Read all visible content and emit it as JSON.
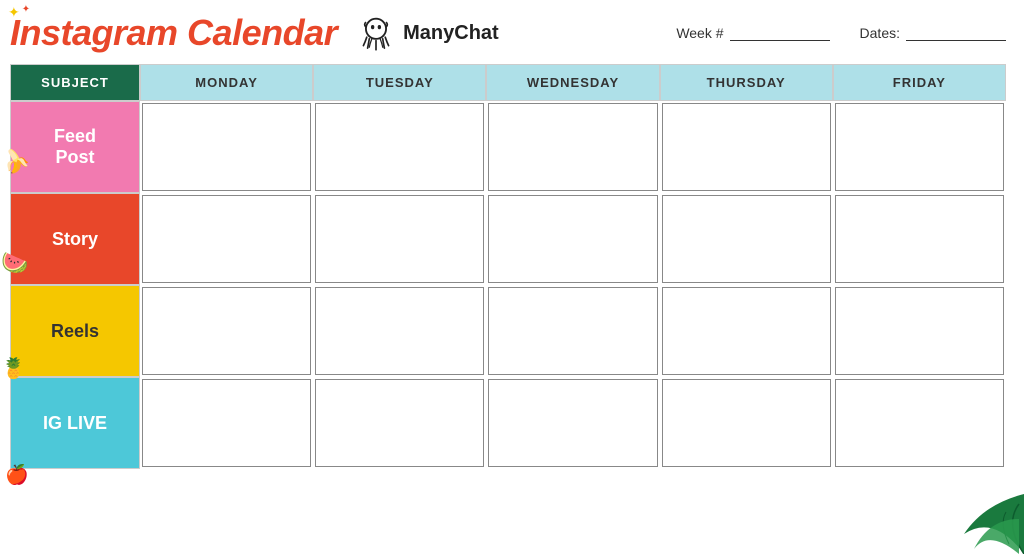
{
  "header": {
    "title": "Instagram Calendar",
    "logo_text": "ManyChat",
    "week_label": "Week #",
    "dates_label": "Dates:"
  },
  "calendar": {
    "columns": [
      "SUBJECT",
      "MONDAY",
      "TUESDAY",
      "WEDNESDAY",
      "THURSDAY",
      "FRIDAY"
    ],
    "rows": [
      {
        "id": "feed-post",
        "label": "Feed\nPost",
        "class": "feed-post"
      },
      {
        "id": "story",
        "label": "Story",
        "class": "story"
      },
      {
        "id": "reels",
        "label": "Reels",
        "class": "reels"
      },
      {
        "id": "ig-live",
        "label": "IG LIVE",
        "class": "ig-live"
      }
    ]
  },
  "decorations": {
    "top_left": "✦",
    "banana": "🍌",
    "watermelon": "🍉",
    "pineapple": "🍍",
    "apple": "🍎"
  }
}
